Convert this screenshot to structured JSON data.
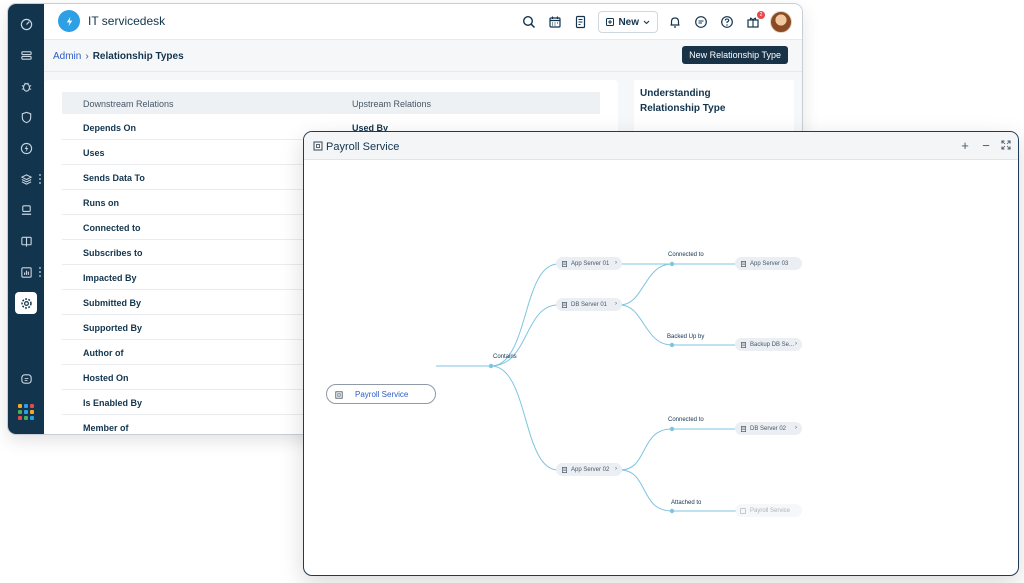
{
  "app": {
    "title": "IT servicedesk"
  },
  "topbar": {
    "new_label": "New",
    "notification_count": "2"
  },
  "breadcrumb": {
    "root": "Admin",
    "current": "Relationship Types"
  },
  "page": {
    "primary_button": "New Relationship Type"
  },
  "table": {
    "headers": [
      "Downstream Relations",
      "Upstream Relations"
    ],
    "rows": [
      {
        "downstream": "Depends On",
        "upstream": "Used By"
      },
      {
        "downstream": "Uses",
        "upstream": ""
      },
      {
        "downstream": "Sends Data To",
        "upstream": ""
      },
      {
        "downstream": "Runs on",
        "upstream": ""
      },
      {
        "downstream": "Connected to",
        "upstream": ""
      },
      {
        "downstream": "Subscribes to",
        "upstream": ""
      },
      {
        "downstream": "Impacted By",
        "upstream": ""
      },
      {
        "downstream": "Submitted By",
        "upstream": ""
      },
      {
        "downstream": "Supported By",
        "upstream": ""
      },
      {
        "downstream": "Author of",
        "upstream": ""
      },
      {
        "downstream": "Hosted On",
        "upstream": ""
      },
      {
        "downstream": "Is Enabled By",
        "upstream": ""
      },
      {
        "downstream": "Member of",
        "upstream": ""
      }
    ]
  },
  "side_panel": {
    "title": "Understanding Relationship Type"
  },
  "map": {
    "title": "Payroll Service",
    "controls": {
      "zoom_in": "+",
      "zoom_out": "−"
    },
    "root": "Payroll Service",
    "edge_labels": {
      "contains": "Contains",
      "connected_to_1": "Connected to",
      "backed_up_by": "Backed Up by",
      "connected_to_2": "Connected to",
      "attached_to": "Attached to"
    },
    "nodes": {
      "app_server_01": "App Server 01",
      "db_server_01": "DB Server 01",
      "app_server_02": "App Server 02",
      "app_server_03": "App Server 03",
      "backup_db": "Backup DB Se...",
      "db_server_02": "DB Server 02",
      "payroll_faded": "Payroll Service"
    }
  },
  "colors": {
    "sidebar": "#12344d",
    "edge": "#7fc4e0",
    "link": "#2c5cc5",
    "primary": "#183247"
  }
}
